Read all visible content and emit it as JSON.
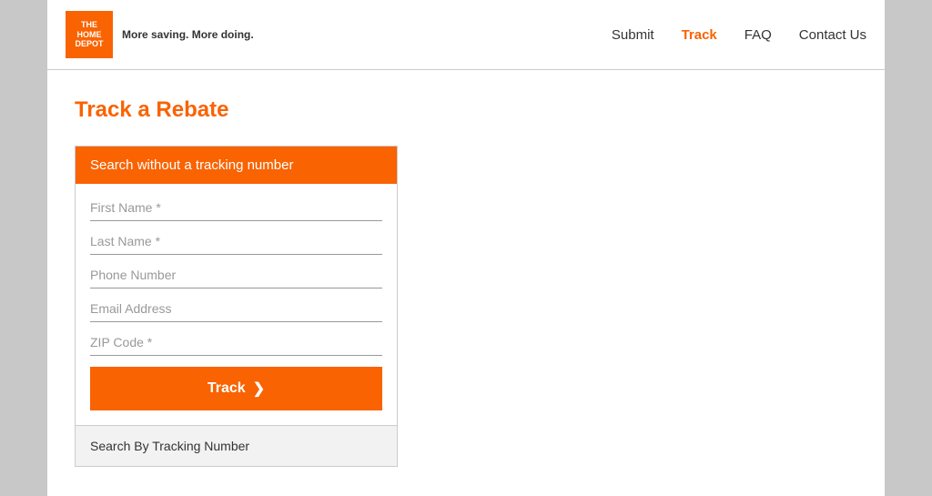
{
  "header": {
    "logo_tagline": "More saving.",
    "logo_tagline_bold": "More doing.",
    "logo_text_line1": "THE",
    "logo_text_line2": "HOME",
    "logo_text_line3": "DEPOT"
  },
  "nav": {
    "items": [
      {
        "label": "Submit",
        "id": "submit",
        "active": false
      },
      {
        "label": "Track",
        "id": "track",
        "active": true
      },
      {
        "label": "FAQ",
        "id": "faq",
        "active": false
      },
      {
        "label": "Contact Us",
        "id": "contact-us",
        "active": false
      }
    ]
  },
  "main": {
    "page_title": "Track a Rebate",
    "form_card": {
      "header": "Search without a tracking number",
      "fields": [
        {
          "id": "first-name",
          "placeholder": "First Name *"
        },
        {
          "id": "last-name",
          "placeholder": "Last Name *"
        },
        {
          "id": "phone-number",
          "placeholder": "Phone Number"
        },
        {
          "id": "email-address",
          "placeholder": "Email Address"
        },
        {
          "id": "zip-code",
          "placeholder": "ZIP Code *"
        }
      ],
      "track_button_label": "Track",
      "track_button_chevron": "❯",
      "search_by_tracking": "Search By Tracking Number"
    }
  },
  "colors": {
    "orange": "#f96302",
    "white": "#ffffff",
    "gray_bg": "#f2f2f2",
    "border": "#cccccc"
  }
}
